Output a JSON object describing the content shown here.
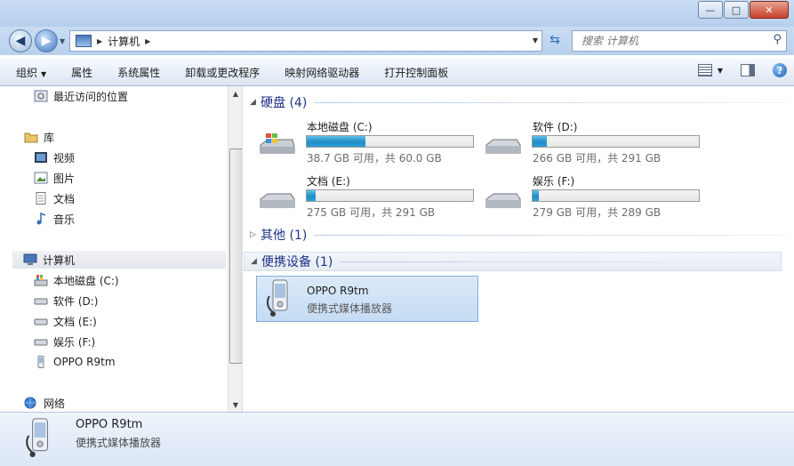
{
  "window": {
    "minimize_glyph": "—",
    "maximize_glyph": "□",
    "close_glyph": "✕"
  },
  "nav": {
    "back_glyph": "◀",
    "forward_glyph": "▶",
    "address_crumb": "计算机",
    "search_placeholder": "搜索 计算机"
  },
  "toolbar": {
    "organize": "组织",
    "properties": "属性",
    "system_properties": "系统属性",
    "uninstall": "卸载或更改程序",
    "map_drive": "映射网络驱动器",
    "control_panel": "打开控制面板"
  },
  "sidebar": {
    "recent": "最近访问的位置",
    "libraries": "库",
    "videos": "视频",
    "pictures": "图片",
    "documents": "文档",
    "music": "音乐",
    "computer": "计算机",
    "drive_c": "本地磁盘 (C:)",
    "drive_d": "软件 (D:)",
    "drive_e": "文档 (E:)",
    "drive_f": "娱乐 (F:)",
    "phone": "OPPO R9tm",
    "network": "网络"
  },
  "groups": {
    "drives": "硬盘 (4)",
    "other": "其他 (1)",
    "portable": "便携设备 (1)"
  },
  "drives": [
    {
      "name": "本地磁盘 (C:)",
      "info": "38.7 GB 可用，共 60.0 GB",
      "used_fraction": 0.355
    },
    {
      "name": "软件 (D:)",
      "info": "266 GB 可用，共 291 GB",
      "used_fraction": 0.086
    },
    {
      "name": "文档 (E:)",
      "info": "275 GB 可用，共 291 GB",
      "used_fraction": 0.055
    },
    {
      "name": "娱乐 (F:)",
      "info": "279 GB 可用，共 289 GB",
      "used_fraction": 0.035
    }
  ],
  "device": {
    "name": "OPPO R9tm",
    "desc": "便携式媒体播放器"
  },
  "details": {
    "name": "OPPO R9tm",
    "desc": "便携式媒体播放器"
  }
}
